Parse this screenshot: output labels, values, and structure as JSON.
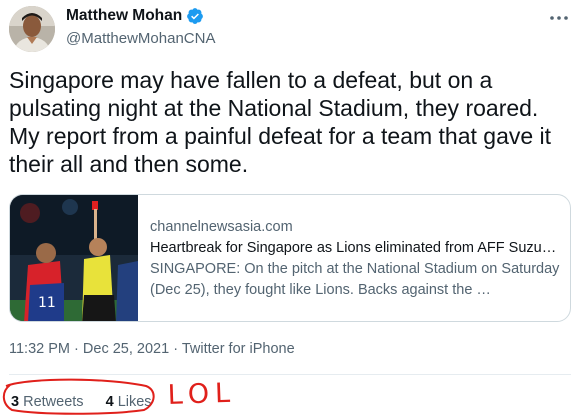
{
  "author": {
    "name": "Matthew Mohan",
    "handle": "@MatthewMohanCNA",
    "verified_icon": "verified-badge-icon",
    "accent": "#1d9bf0"
  },
  "tweet": {
    "text": "Singapore may have fallen to a defeat, but on a pulsating night at the National Stadium, they roared. My report from a painful defeat for a team that gave it their all and then some."
  },
  "card": {
    "domain": "channelnewsasia.com",
    "title": "Heartbreak for Singapore as Lions eliminated from AFF Suzu…",
    "description": "SINGAPORE: On the pitch at the National Stadium on Saturday (Dec 25), they fought like Lions. Backs against the …"
  },
  "meta": {
    "time": "11:32 PM",
    "date": "Dec 25, 2021",
    "source": "Twitter for iPhone",
    "separator": "·"
  },
  "stats": {
    "retweets_count": "3",
    "retweets_label": "Retweets",
    "likes_count": "4",
    "likes_label": "Likes"
  },
  "annotation": {
    "text": "LOL",
    "color": "#e0201b"
  }
}
